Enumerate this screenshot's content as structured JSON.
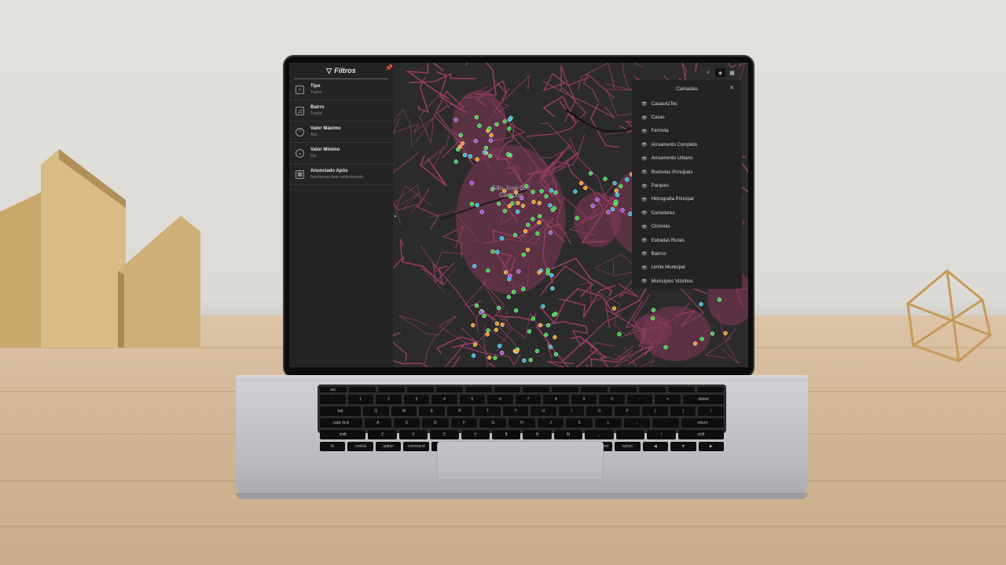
{
  "filters": {
    "title": "Filtros",
    "items": [
      {
        "label": "Tipo",
        "value": "Todos",
        "icon": "house-icon"
      },
      {
        "label": "Bairro",
        "value": "Todos",
        "icon": "map-area-icon"
      },
      {
        "label": "Valor Máximo",
        "value": "Até:",
        "icon": "chevron-up-circle-icon"
      },
      {
        "label": "Valor Mínimo",
        "value": "De:",
        "icon": "chevron-down-circle-icon"
      },
      {
        "label": "Anunciado Após",
        "value": "Nenhuma data selecionada",
        "icon": "calendar-icon"
      }
    ]
  },
  "map": {
    "city_label_line1": "São José dos",
    "city_label_line2": "Campos",
    "colors": {
      "background": "#2b2b2b",
      "roads": "#9a3d63",
      "water": "#1e1e1e"
    }
  },
  "layers": {
    "title": "Camadas",
    "items": [
      "CasasAzTec",
      "Casas",
      "Ferrovia",
      "Arruamento Completo",
      "Arruamento Urbano",
      "Rodovias Principais",
      "Parques",
      "Hidrografia Principal",
      "Corredores",
      "Ciclovias",
      "Estradas Rurais",
      "Bairros",
      "Limite Municipal",
      "Municípios Vizinhos"
    ]
  },
  "keyboard": {
    "row1": [
      "esc",
      "",
      "",
      "",
      "",
      "",
      "",
      "",
      "",
      "",
      "",
      "",
      "",
      ""
    ],
    "row2": [
      "`",
      "1",
      "2",
      "3",
      "4",
      "5",
      "6",
      "7",
      "8",
      "9",
      "0",
      "-",
      "=",
      "delete"
    ],
    "row3": [
      "tab",
      "Q",
      "W",
      "E",
      "R",
      "T",
      "Y",
      "U",
      "I",
      "O",
      "P",
      "[",
      "]",
      "\\"
    ],
    "row4": [
      "caps lock",
      "A",
      "S",
      "D",
      "F",
      "G",
      "H",
      "J",
      "K",
      "L",
      ";",
      "'",
      "return"
    ],
    "row5": [
      "shift",
      "Z",
      "X",
      "C",
      "V",
      "B",
      "N",
      "M",
      ",",
      ".",
      "/",
      "shift"
    ],
    "row6": [
      "fn",
      "control",
      "option",
      "command",
      "",
      "command",
      "option",
      "◀",
      "▼",
      "▶"
    ]
  }
}
